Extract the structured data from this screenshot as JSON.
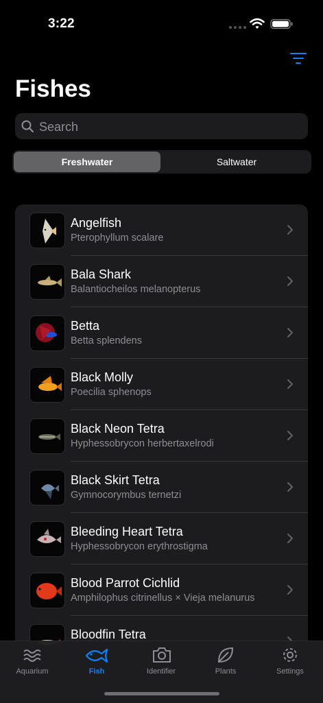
{
  "status_bar": {
    "time": "3:22"
  },
  "header": {
    "title": "Fishes"
  },
  "search": {
    "placeholder": "Search",
    "value": ""
  },
  "segments": {
    "selected": "Freshwater",
    "items": [
      "Freshwater",
      "Saltwater"
    ]
  },
  "fish_list": [
    {
      "name": "Angelfish",
      "scientific": "Pterophyllum scalare",
      "color": "#d9d2c5"
    },
    {
      "name": "Bala Shark",
      "scientific": "Balantiocheilos melanopterus",
      "color": "#c9b27a"
    },
    {
      "name": "Betta",
      "scientific": "Betta splendens",
      "color": "#b0182a"
    },
    {
      "name": "Black Molly",
      "scientific": "Poecilia sphenops",
      "color": "#f0a020"
    },
    {
      "name": "Black Neon Tetra",
      "scientific": "Hyphessobrycon herbertaxelrodi",
      "color": "#8a8f7a"
    },
    {
      "name": "Black Skirt Tetra",
      "scientific": "Gymnocorymbus ternetzi",
      "color": "#6f8aa8"
    },
    {
      "name": "Bleeding Heart Tetra",
      "scientific": "Hyphessobrycon erythrostigma",
      "color": "#c8b4b4"
    },
    {
      "name": "Blood Parrot Cichlid",
      "scientific": "Amphilophus citrinellus × Vieja melanurus",
      "color": "#e2381c"
    },
    {
      "name": "Bloodfin Tetra",
      "scientific": "",
      "color": "#d8d0c0"
    }
  ],
  "tab_bar": {
    "active": "Fish",
    "items": [
      {
        "label": "Aquarium",
        "icon": "waves-icon"
      },
      {
        "label": "Fish",
        "icon": "fish-icon"
      },
      {
        "label": "Identifier",
        "icon": "camera-icon"
      },
      {
        "label": "Plants",
        "icon": "leaf-icon"
      },
      {
        "label": "Settings",
        "icon": "gear-icon"
      }
    ]
  },
  "colors": {
    "accent": "#0a84ff",
    "background": "#000000",
    "card": "#1c1c1e",
    "secondary_text": "#8e8e93"
  }
}
